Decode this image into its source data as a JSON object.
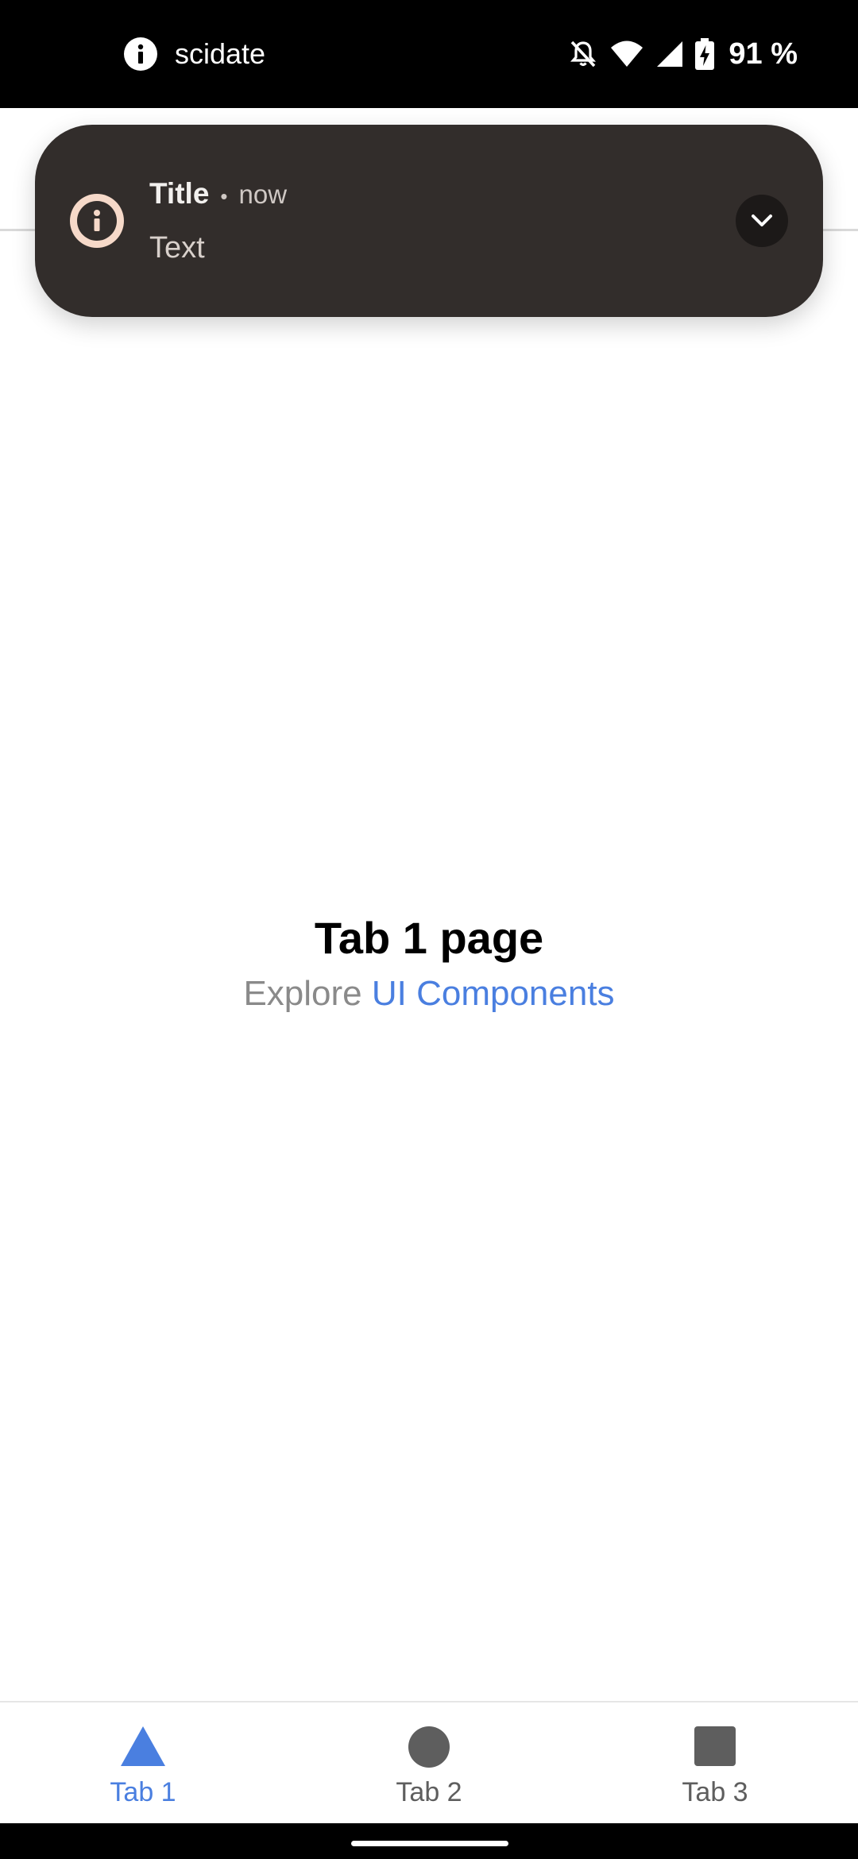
{
  "status_bar": {
    "app_name": "scidate",
    "battery": "91 %",
    "icons": [
      "info-icon",
      "notifications-off-icon",
      "wifi-icon",
      "signal-icon",
      "battery-charging-icon"
    ]
  },
  "notification": {
    "title": "Title",
    "separator": "•",
    "time": "now",
    "text": "Text",
    "icon": "info-icon",
    "expand_icon": "chevron-down-icon",
    "colors": {
      "background": "#322d2b",
      "icon_accent": "#f6d9c9"
    }
  },
  "main": {
    "title": "Tab 1 page",
    "subtitle_prefix": "Explore ",
    "subtitle_link": "UI Components"
  },
  "tab_bar": {
    "active_color": "#4a7fe0",
    "inactive_color": "#5e5e5e",
    "tabs": [
      {
        "label": "Tab 1",
        "icon": "triangle-icon",
        "active": true
      },
      {
        "label": "Tab 2",
        "icon": "circle-icon",
        "active": false
      },
      {
        "label": "Tab 3",
        "icon": "square-icon",
        "active": false
      }
    ]
  }
}
